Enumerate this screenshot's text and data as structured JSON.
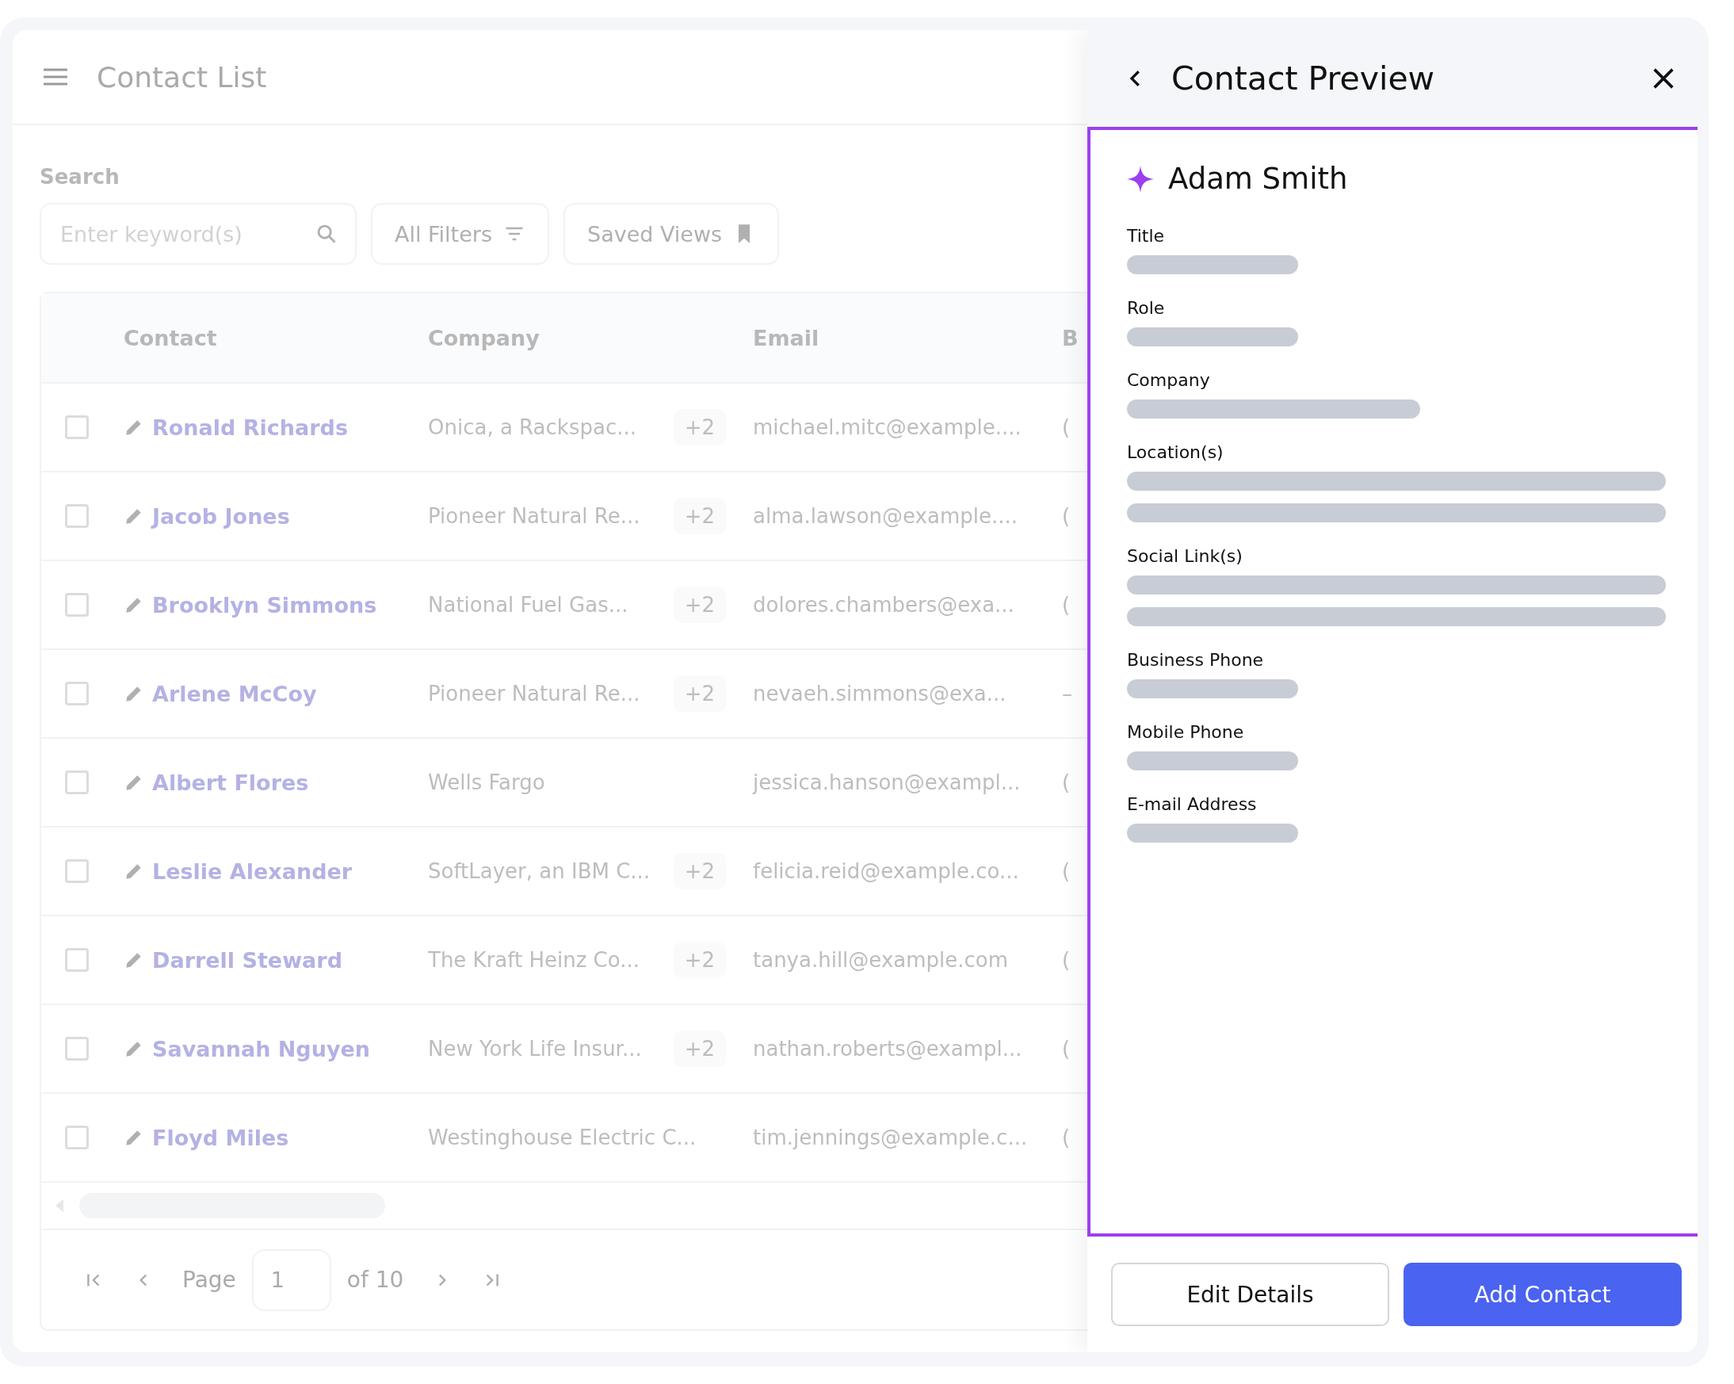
{
  "header": {
    "title": "Contact List"
  },
  "search": {
    "label": "Search",
    "placeholder": "Enter keyword(s)",
    "filters_button": "All Filters",
    "saved_views_button": "Saved Views"
  },
  "table": {
    "columns": [
      "Contact",
      "Company",
      "Email",
      "B"
    ],
    "rows": [
      {
        "checked": false,
        "contact": "Ronald Richards",
        "company": "Onica, a Rackspac...",
        "extra": "+2",
        "email": "michael.mitc@example....",
        "column_4": "("
      },
      {
        "checked": false,
        "contact": "Jacob Jones",
        "company": "Pioneer Natural Re...",
        "extra": "+2",
        "email": "alma.lawson@example....",
        "column_4": "("
      },
      {
        "checked": false,
        "contact": "Brooklyn Simmons",
        "company": "National Fuel Gas...",
        "extra": "+2",
        "email": "dolores.chambers@exa...",
        "column_4": "("
      },
      {
        "checked": false,
        "contact": "Arlene McCoy",
        "company": "Pioneer Natural Re...",
        "extra": "+2",
        "email": "nevaeh.simmons@exa...",
        "column_4": "–"
      },
      {
        "checked": false,
        "contact": "Albert Flores",
        "company": "Wells Fargo",
        "email": "jessica.hanson@exampl...",
        "column_4": "("
      },
      {
        "checked": false,
        "contact": "Leslie Alexander",
        "company": "SoftLayer, an IBM C...",
        "extra": "+2",
        "email": "felicia.reid@example.co...",
        "column_4": "("
      },
      {
        "checked": false,
        "contact": "Darrell Steward",
        "company": "The Kraft Heinz Co...",
        "extra": "+2",
        "email": "tanya.hill@example.com",
        "column_4": "("
      },
      {
        "checked": false,
        "contact": "Savannah Nguyen",
        "company": "New York Life Insur...",
        "extra": "+2",
        "email": "nathan.roberts@exampl...",
        "column_4": "("
      },
      {
        "checked": false,
        "contact": "Floyd Miles",
        "company": "Westinghouse Electric C...",
        "email": "tim.jennings@example.c...",
        "column_4": "("
      }
    ]
  },
  "pagination": {
    "label": "Page",
    "value": "1",
    "total": "of 10"
  },
  "preview": {
    "title": "Contact Preview",
    "name": "Adam Smith",
    "fields": [
      {
        "label": "Title",
        "lines": [
          {
            "kind": "short"
          }
        ]
      },
      {
        "label": "Role",
        "lines": [
          {
            "kind": "short"
          }
        ]
      },
      {
        "label": "Company",
        "lines": [
          {
            "kind": "medium"
          }
        ]
      },
      {
        "label": "Location(s)",
        "lines": [
          {
            "kind": "long"
          },
          {
            "kind": "long"
          }
        ]
      },
      {
        "label": "Social Link(s)",
        "lines": [
          {
            "kind": "long"
          },
          {
            "kind": "long"
          }
        ]
      },
      {
        "label": "Business Phone",
        "lines": [
          {
            "kind": "short"
          }
        ]
      },
      {
        "label": "Mobile Phone",
        "lines": [
          {
            "kind": "short"
          }
        ]
      },
      {
        "label": "E-mail Address",
        "lines": [
          {
            "kind": "short"
          }
        ]
      }
    ],
    "buttons": [
      {
        "label": "Edit Details",
        "kind": "secondary"
      },
      {
        "label": "Add Contact",
        "kind": "primary"
      }
    ]
  }
}
